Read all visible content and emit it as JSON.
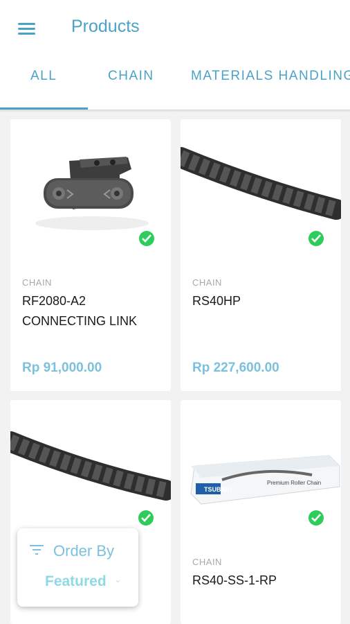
{
  "app": {
    "title": "Products"
  },
  "tabs": [
    {
      "label": "ALL",
      "active": true
    },
    {
      "label": "CHAIN",
      "active": false
    },
    {
      "label": "MATERIALS HANDLING",
      "active": false
    }
  ],
  "products": [
    {
      "category": "CHAIN",
      "name_line1": "RF2080-A2",
      "name_line2": "CONNECTING LINK",
      "price": "Rp 91,000.00",
      "image": "connecting-link",
      "available": true
    },
    {
      "category": "CHAIN",
      "name_line1": "RS40HP",
      "name_line2": "",
      "price": "Rp 227,600.00",
      "image": "roller-chain",
      "available": true
    },
    {
      "category": "",
      "name_line1": "",
      "name_line2": "",
      "price": "",
      "image": "roller-chain",
      "available": true
    },
    {
      "category": "CHAIN",
      "name_line1": "RS40-SS-1-RP",
      "name_line2": "",
      "price": "",
      "image": "chain-box",
      "available": true
    }
  ],
  "box_brand": "TSUBAKI",
  "box_caption": "Premium Roller Chain",
  "order": {
    "label": "Order By",
    "value": "Featured"
  },
  "colors": {
    "accent": "#4aa3c7",
    "price": "#7cc0dd",
    "check": "#2ecc5a"
  }
}
